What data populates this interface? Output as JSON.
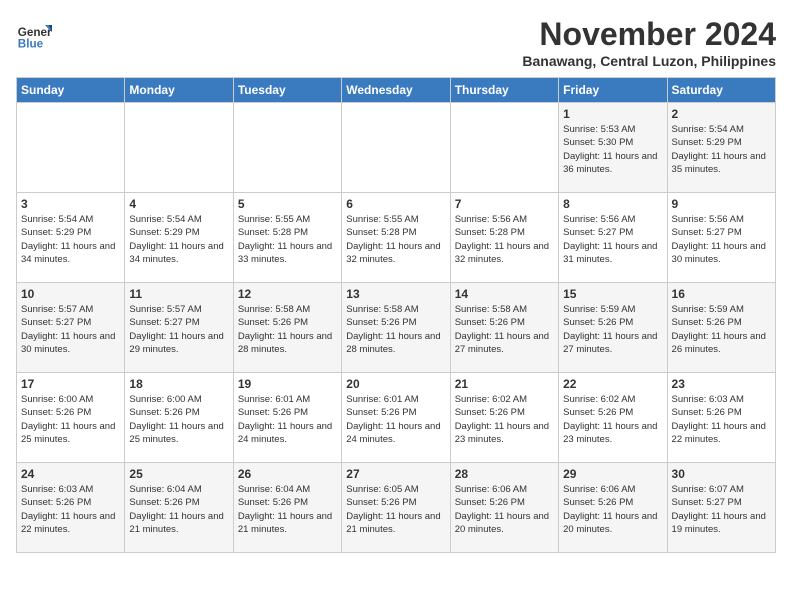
{
  "header": {
    "logo_line1": "General",
    "logo_line2": "Blue",
    "month": "November 2024",
    "location": "Banawang, Central Luzon, Philippines"
  },
  "weekdays": [
    "Sunday",
    "Monday",
    "Tuesday",
    "Wednesday",
    "Thursday",
    "Friday",
    "Saturday"
  ],
  "weeks": [
    [
      {
        "num": "",
        "info": ""
      },
      {
        "num": "",
        "info": ""
      },
      {
        "num": "",
        "info": ""
      },
      {
        "num": "",
        "info": ""
      },
      {
        "num": "",
        "info": ""
      },
      {
        "num": "1",
        "info": "Sunrise: 5:53 AM\nSunset: 5:30 PM\nDaylight: 11 hours and 36 minutes."
      },
      {
        "num": "2",
        "info": "Sunrise: 5:54 AM\nSunset: 5:29 PM\nDaylight: 11 hours and 35 minutes."
      }
    ],
    [
      {
        "num": "3",
        "info": "Sunrise: 5:54 AM\nSunset: 5:29 PM\nDaylight: 11 hours and 34 minutes."
      },
      {
        "num": "4",
        "info": "Sunrise: 5:54 AM\nSunset: 5:29 PM\nDaylight: 11 hours and 34 minutes."
      },
      {
        "num": "5",
        "info": "Sunrise: 5:55 AM\nSunset: 5:28 PM\nDaylight: 11 hours and 33 minutes."
      },
      {
        "num": "6",
        "info": "Sunrise: 5:55 AM\nSunset: 5:28 PM\nDaylight: 11 hours and 32 minutes."
      },
      {
        "num": "7",
        "info": "Sunrise: 5:56 AM\nSunset: 5:28 PM\nDaylight: 11 hours and 32 minutes."
      },
      {
        "num": "8",
        "info": "Sunrise: 5:56 AM\nSunset: 5:27 PM\nDaylight: 11 hours and 31 minutes."
      },
      {
        "num": "9",
        "info": "Sunrise: 5:56 AM\nSunset: 5:27 PM\nDaylight: 11 hours and 30 minutes."
      }
    ],
    [
      {
        "num": "10",
        "info": "Sunrise: 5:57 AM\nSunset: 5:27 PM\nDaylight: 11 hours and 30 minutes."
      },
      {
        "num": "11",
        "info": "Sunrise: 5:57 AM\nSunset: 5:27 PM\nDaylight: 11 hours and 29 minutes."
      },
      {
        "num": "12",
        "info": "Sunrise: 5:58 AM\nSunset: 5:26 PM\nDaylight: 11 hours and 28 minutes."
      },
      {
        "num": "13",
        "info": "Sunrise: 5:58 AM\nSunset: 5:26 PM\nDaylight: 11 hours and 28 minutes."
      },
      {
        "num": "14",
        "info": "Sunrise: 5:58 AM\nSunset: 5:26 PM\nDaylight: 11 hours and 27 minutes."
      },
      {
        "num": "15",
        "info": "Sunrise: 5:59 AM\nSunset: 5:26 PM\nDaylight: 11 hours and 27 minutes."
      },
      {
        "num": "16",
        "info": "Sunrise: 5:59 AM\nSunset: 5:26 PM\nDaylight: 11 hours and 26 minutes."
      }
    ],
    [
      {
        "num": "17",
        "info": "Sunrise: 6:00 AM\nSunset: 5:26 PM\nDaylight: 11 hours and 25 minutes."
      },
      {
        "num": "18",
        "info": "Sunrise: 6:00 AM\nSunset: 5:26 PM\nDaylight: 11 hours and 25 minutes."
      },
      {
        "num": "19",
        "info": "Sunrise: 6:01 AM\nSunset: 5:26 PM\nDaylight: 11 hours and 24 minutes."
      },
      {
        "num": "20",
        "info": "Sunrise: 6:01 AM\nSunset: 5:26 PM\nDaylight: 11 hours and 24 minutes."
      },
      {
        "num": "21",
        "info": "Sunrise: 6:02 AM\nSunset: 5:26 PM\nDaylight: 11 hours and 23 minutes."
      },
      {
        "num": "22",
        "info": "Sunrise: 6:02 AM\nSunset: 5:26 PM\nDaylight: 11 hours and 23 minutes."
      },
      {
        "num": "23",
        "info": "Sunrise: 6:03 AM\nSunset: 5:26 PM\nDaylight: 11 hours and 22 minutes."
      }
    ],
    [
      {
        "num": "24",
        "info": "Sunrise: 6:03 AM\nSunset: 5:26 PM\nDaylight: 11 hours and 22 minutes."
      },
      {
        "num": "25",
        "info": "Sunrise: 6:04 AM\nSunset: 5:26 PM\nDaylight: 11 hours and 21 minutes."
      },
      {
        "num": "26",
        "info": "Sunrise: 6:04 AM\nSunset: 5:26 PM\nDaylight: 11 hours and 21 minutes."
      },
      {
        "num": "27",
        "info": "Sunrise: 6:05 AM\nSunset: 5:26 PM\nDaylight: 11 hours and 21 minutes."
      },
      {
        "num": "28",
        "info": "Sunrise: 6:06 AM\nSunset: 5:26 PM\nDaylight: 11 hours and 20 minutes."
      },
      {
        "num": "29",
        "info": "Sunrise: 6:06 AM\nSunset: 5:26 PM\nDaylight: 11 hours and 20 minutes."
      },
      {
        "num": "30",
        "info": "Sunrise: 6:07 AM\nSunset: 5:27 PM\nDaylight: 11 hours and 19 minutes."
      }
    ]
  ]
}
